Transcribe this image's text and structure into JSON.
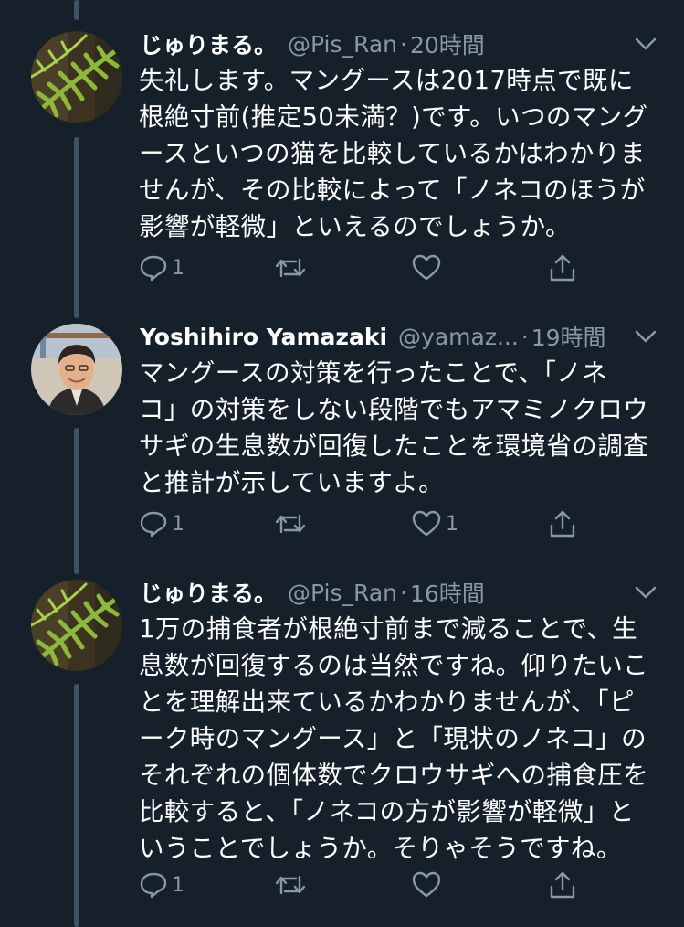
{
  "tweets": [
    {
      "display_name": "じゅりまる。",
      "handle": "@Pis_Ran",
      "separator": "·",
      "time": "20時間",
      "body": "失礼します。マングースは2017時点で既に\n根絶寸前(推定50未満？)です。いつのマング\nースといつの猫を比較しているかはわかりま\nせんが、その比較によって「ノネコのほうが\n影響が軽微」といえるのでしょうか。",
      "reply_count": "1",
      "retweet_count": "",
      "like_count": "",
      "avatar": "fern-leaf-photo"
    },
    {
      "display_name": "Yoshihiro Yamazaki",
      "handle": "@yamaz...",
      "separator": "·",
      "time": "19時間",
      "body": "マングースの対策を行ったことで、「ノネ\nコ」の対策をしない段階でもアマミノクロウ\nサギの生息数が回復したことを環境省の調査\nと推計が示していますよ。",
      "reply_count": "1",
      "retweet_count": "",
      "like_count": "1",
      "avatar": "man-portrait-photo"
    },
    {
      "display_name": "じゅりまる。",
      "handle": "@Pis_Ran",
      "separator": "·",
      "time": "16時間",
      "body": "1万の捕食者が根絶寸前まで減ることで、生\n息数が回復するのは当然ですね。仰りたいこ\nとを理解出来ているかわかりませんが、「ピ\nーク時のマングース」と「現状のノネコ」の\nそれぞれの個体数でクロウサギへの捕食圧を\n比較すると、「ノネコの方が影響が軽微」と\nいうことでしょうか。そりゃそうですね。",
      "reply_count": "1",
      "retweet_count": "",
      "like_count": "",
      "avatar": "fern-leaf-photo"
    }
  ],
  "icons": {
    "reply": "reply-icon",
    "retweet": "retweet-icon",
    "like": "like-icon",
    "share": "share-icon",
    "menu": "chevron-down-icon"
  },
  "colors": {
    "background": "#15202b",
    "secondary_text": "#8899a6",
    "thread_line": "#3d5466"
  }
}
